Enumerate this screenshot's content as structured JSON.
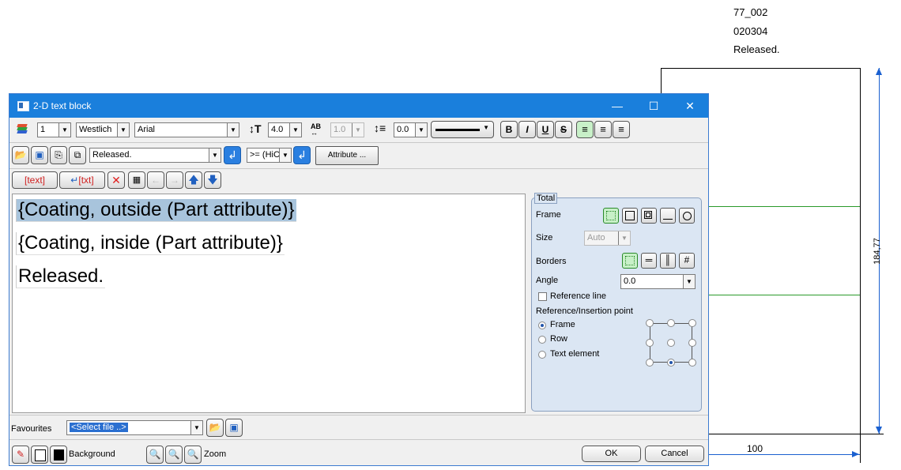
{
  "drawing": {
    "lines": [
      "77_002",
      "020304",
      "Released."
    ],
    "dim_vertical": "184,77",
    "dim_horizontal": "100"
  },
  "dialog": {
    "title": "2-D text block",
    "toolbar1": {
      "layer": "1",
      "pen": "Westlich",
      "font": "Arial",
      "height": "4.0",
      "ratio": "1.0",
      "spacing": "0.0"
    },
    "toolbar2": {
      "text_value": "Released.",
      "operator": ">= (HiC",
      "attribute_label": "Attribute ..."
    },
    "toolbar3": {
      "text_label": "text",
      "txt_label": "txt"
    },
    "editor_lines": [
      "{Coating, outside (Part attribute)}",
      "{Coating, inside (Part attribute)}",
      "Released."
    ],
    "panel": {
      "group_title": "Total",
      "frame_label": "Frame",
      "size_label": "Size",
      "size_value": "Auto",
      "borders_label": "Borders",
      "angle_label": "Angle",
      "angle_value": "0.0",
      "reference_line_label": "Reference line",
      "reference_point_label": "Reference/Insertion point",
      "radio_frame": "Frame",
      "radio_row": "Row",
      "radio_text_element": "Text element"
    },
    "favourites_label": "Favourites",
    "favourites_value": "<Select file ..>",
    "background_label": "Background",
    "zoom_label": "Zoom",
    "ok_label": "OK",
    "cancel_label": "Cancel"
  },
  "colors": {
    "titlebar": "#1a7fdc",
    "selection": "#a8c4dc",
    "green_line": "#2a9a2a",
    "dimension": "#1a60d0"
  }
}
